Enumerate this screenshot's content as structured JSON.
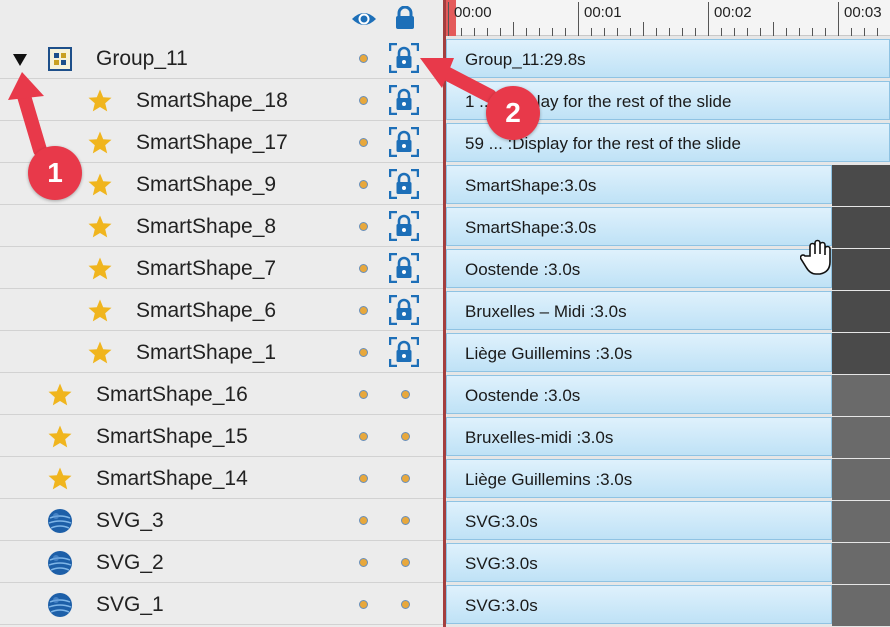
{
  "colors": {
    "accent": "#1d6fb8",
    "divider": "#a33e3e",
    "callout": "#e8394a",
    "star": "#f0b51e"
  },
  "header": {
    "visibility_icon": "eye-icon",
    "lock_icon": "lock-icon"
  },
  "ruler": {
    "ticks": [
      "00:00",
      "00:01",
      "00:02",
      "00:03"
    ]
  },
  "rows": [
    {
      "label": "Group_11",
      "icon": "group-icon",
      "indent": 0,
      "lock": "locked",
      "expanded": true,
      "track": "Group_11:29.8s",
      "bar": "full"
    },
    {
      "label": "SmartShape_18",
      "icon": "star-icon",
      "indent": 1,
      "lock": "locked",
      "track": "1 ... :Display for the rest of the slide",
      "bar": "full"
    },
    {
      "label": "SmartShape_17",
      "icon": "star-icon",
      "indent": 1,
      "lock": "locked",
      "track": "59 ... :Display for the rest of the slide",
      "bar": "full"
    },
    {
      "label": "SmartShape_9",
      "icon": "star-icon",
      "indent": 1,
      "lock": "locked",
      "track": "SmartShape:3.0s",
      "bar": "dark"
    },
    {
      "label": "SmartShape_8",
      "icon": "star-icon",
      "indent": 1,
      "lock": "locked",
      "track": "SmartShape:3.0s",
      "bar": "dark"
    },
    {
      "label": "SmartShape_7",
      "icon": "star-icon",
      "indent": 1,
      "lock": "locked",
      "track": "Oostende :3.0s",
      "bar": "dark"
    },
    {
      "label": "SmartShape_6",
      "icon": "star-icon",
      "indent": 1,
      "lock": "locked",
      "track": "Bruxelles – Midi :3.0s",
      "bar": "dark"
    },
    {
      "label": "SmartShape_1",
      "icon": "star-icon",
      "indent": 1,
      "lock": "locked",
      "track": "Liège Guillemins :3.0s",
      "bar": "dark"
    },
    {
      "label": "SmartShape_16",
      "icon": "star-icon",
      "indent": 0,
      "lock": "unlocked",
      "track": "Oostende :3.0s",
      "bar": "mid"
    },
    {
      "label": "SmartShape_15",
      "icon": "star-icon",
      "indent": 0,
      "lock": "unlocked",
      "track": "Bruxelles-midi :3.0s",
      "bar": "mid"
    },
    {
      "label": "SmartShape_14",
      "icon": "star-icon",
      "indent": 0,
      "lock": "unlocked",
      "track": "Liège Guillemins :3.0s",
      "bar": "mid"
    },
    {
      "label": "SVG_3",
      "icon": "globe-icon",
      "indent": 0,
      "lock": "unlocked",
      "track": "SVG:3.0s",
      "bar": "mid"
    },
    {
      "label": "SVG_2",
      "icon": "globe-icon",
      "indent": 0,
      "lock": "unlocked",
      "track": "SVG:3.0s",
      "bar": "mid"
    },
    {
      "label": "SVG_1",
      "icon": "globe-icon",
      "indent": 0,
      "lock": "unlocked",
      "track": "SVG:3.0s",
      "bar": "mid"
    }
  ],
  "callouts": [
    "1",
    "2"
  ]
}
